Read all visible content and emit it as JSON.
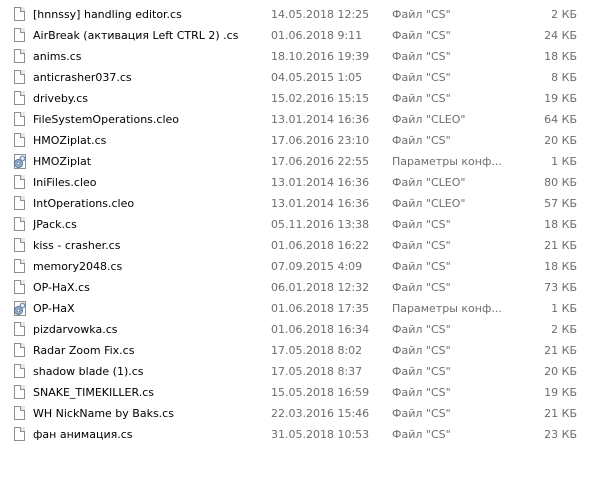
{
  "files": [
    {
      "name": "[hnnssy] handling editor.cs",
      "date": "14.05.2018 12:25",
      "type": "Файл \"CS\"",
      "size": "2 КБ",
      "icon": "document-icon"
    },
    {
      "name": "AirBreak (активация Left CTRL   2) .cs",
      "date": "01.06.2018 9:11",
      "type": "Файл \"CS\"",
      "size": "24 КБ",
      "icon": "document-icon"
    },
    {
      "name": "anims.cs",
      "date": "18.10.2016 19:39",
      "type": "Файл \"CS\"",
      "size": "18 КБ",
      "icon": "document-icon"
    },
    {
      "name": "anticrasher037.cs",
      "date": "04.05.2015 1:05",
      "type": "Файл \"CS\"",
      "size": "8 КБ",
      "icon": "document-icon"
    },
    {
      "name": "driveby.cs",
      "date": "15.02.2016 15:15",
      "type": "Файл \"CS\"",
      "size": "19 КБ",
      "icon": "document-icon"
    },
    {
      "name": "FileSystemOperations.cleo",
      "date": "13.01.2014 16:36",
      "type": "Файл \"CLEO\"",
      "size": "64 КБ",
      "icon": "document-icon"
    },
    {
      "name": "HMOZiplat.cs",
      "date": "17.06.2016 23:10",
      "type": "Файл \"CS\"",
      "size": "20 КБ",
      "icon": "document-icon"
    },
    {
      "name": "HMOZiplat",
      "date": "17.06.2016 22:55",
      "type": "Параметры конф...",
      "size": "1 КБ",
      "icon": "settings-file-icon"
    },
    {
      "name": "IniFiles.cleo",
      "date": "13.01.2014 16:36",
      "type": "Файл \"CLEO\"",
      "size": "80 КБ",
      "icon": "document-icon"
    },
    {
      "name": "IntOperations.cleo",
      "date": "13.01.2014 16:36",
      "type": "Файл \"CLEO\"",
      "size": "57 КБ",
      "icon": "document-icon"
    },
    {
      "name": "JPack.cs",
      "date": "05.11.2016 13:38",
      "type": "Файл \"CS\"",
      "size": "18 КБ",
      "icon": "document-icon"
    },
    {
      "name": "kiss - crasher.cs",
      "date": "01.06.2018 16:22",
      "type": "Файл \"CS\"",
      "size": "21 КБ",
      "icon": "document-icon"
    },
    {
      "name": "memory2048.cs",
      "date": "07.09.2015 4:09",
      "type": "Файл \"CS\"",
      "size": "18 КБ",
      "icon": "document-icon"
    },
    {
      "name": "OP-HaX.cs",
      "date": "06.01.2018 12:32",
      "type": "Файл \"CS\"",
      "size": "73 КБ",
      "icon": "document-icon"
    },
    {
      "name": "OP-HaX",
      "date": "01.06.2018 17:35",
      "type": "Параметры конф...",
      "size": "1 КБ",
      "icon": "settings-file-icon"
    },
    {
      "name": "pizdarvowka.cs",
      "date": "01.06.2018 16:34",
      "type": "Файл \"CS\"",
      "size": "2 КБ",
      "icon": "document-icon"
    },
    {
      "name": "Radar Zoom Fix.cs",
      "date": "17.05.2018 8:02",
      "type": "Файл \"CS\"",
      "size": "21 КБ",
      "icon": "document-icon"
    },
    {
      "name": "shadow blade (1).cs",
      "date": "17.05.2018 8:37",
      "type": "Файл \"CS\"",
      "size": "20 КБ",
      "icon": "document-icon"
    },
    {
      "name": "SNAKE_TIMEKILLER.cs",
      "date": "15.05.2018 16:59",
      "type": "Файл \"CS\"",
      "size": "19 КБ",
      "icon": "document-icon"
    },
    {
      "name": "WH NickName by Baks.cs",
      "date": "22.03.2016 15:46",
      "type": "Файл \"CS\"",
      "size": "21 КБ",
      "icon": "document-icon"
    },
    {
      "name": "фан анимация.cs",
      "date": "31.05.2018 10:53",
      "type": "Файл \"CS\"",
      "size": "23 КБ",
      "icon": "document-icon"
    }
  ]
}
